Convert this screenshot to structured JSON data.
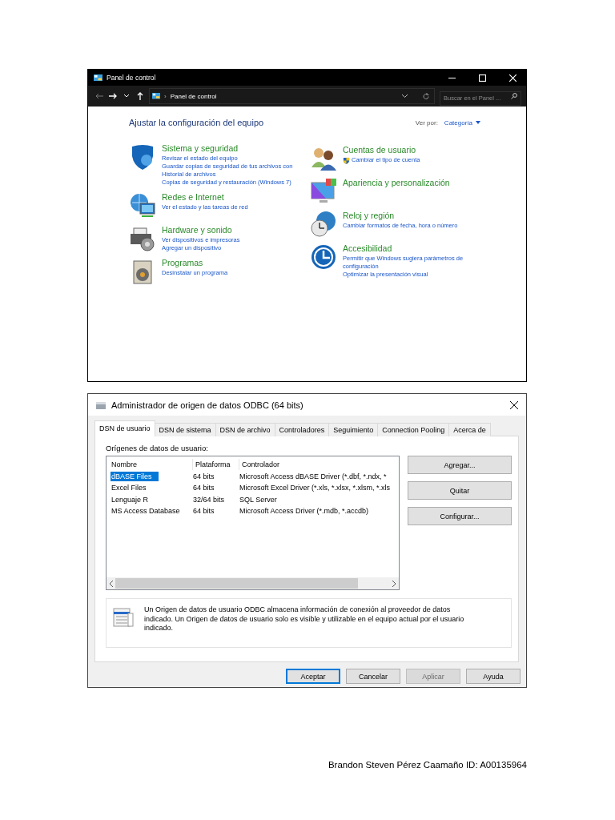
{
  "control_panel": {
    "title": "Panel de control",
    "address": {
      "separator": "›",
      "path": "Panel de control"
    },
    "search": {
      "placeholder": "Buscar en el Panel ..."
    },
    "heading": "Ajustar la configuración del equipo",
    "view_by": {
      "label": "Ver por:",
      "value": "Categoría"
    },
    "left_categories": [
      {
        "title": "Sistema y seguridad",
        "links": [
          {
            "text": "Revisar el estado del equipo",
            "kind": "plain"
          },
          {
            "text": "Guardar copias de seguridad de tus archivos con Historial de archivos",
            "kind": "plain"
          },
          {
            "text": "Copias de seguridad y restauración (Windows 7)",
            "kind": "plain"
          }
        ]
      },
      {
        "title": "Redes e Internet",
        "links": [
          {
            "text": "Ver el estado y las tareas de red",
            "kind": "plain"
          }
        ]
      },
      {
        "title": "Hardware y sonido",
        "links": [
          {
            "text": "Ver dispositivos e impresoras",
            "kind": "plain"
          },
          {
            "text": "Agregar un dispositivo",
            "kind": "plain"
          }
        ]
      },
      {
        "title": "Programas",
        "links": [
          {
            "text": "Desinstalar un programa",
            "kind": "plain"
          }
        ]
      }
    ],
    "right_categories": [
      {
        "title": "Cuentas de usuario",
        "links": [
          {
            "text": "Cambiar el tipo de cuenta",
            "kind": "admin"
          }
        ]
      },
      {
        "title": "Apariencia y personalización"
      },
      {
        "title": "Reloj y región",
        "links": [
          {
            "text": "Cambiar formatos de fecha, hora o número",
            "kind": "plain"
          }
        ]
      },
      {
        "title": "Accesibilidad",
        "links": [
          {
            "text": "Permitir que Windows sugiera parámetros de configuración",
            "kind": "plain"
          },
          {
            "text": "Optimizar la presentación visual",
            "kind": "plain"
          }
        ]
      }
    ]
  },
  "odbc": {
    "title": "Administrador de origen de datos ODBC (64 bits)",
    "tabs": [
      {
        "label": "DSN de usuario",
        "selected": true
      },
      {
        "label": "DSN de sistema",
        "selected": false
      },
      {
        "label": "DSN de archivo",
        "selected": false
      },
      {
        "label": "Controladores",
        "selected": false
      },
      {
        "label": "Seguimiento",
        "selected": false
      },
      {
        "label": "Connection Pooling",
        "selected": false
      },
      {
        "label": "Acerca de",
        "selected": false
      }
    ],
    "list_label": "Orígenes de datos de usuario:",
    "columns": [
      "Nombre",
      "Plataforma",
      "Controlador"
    ],
    "rows": [
      {
        "cells": [
          "dBASE Files",
          "64 bits",
          "Microsoft Access dBASE Driver (*.dbf, *.ndx, *"
        ],
        "selected": true
      },
      {
        "cells": [
          "Excel Files",
          "64 bits",
          "Microsoft Excel Driver (*.xls, *.xlsx, *.xlsm, *.xls"
        ],
        "selected": false
      },
      {
        "cells": [
          "Lenguaje R",
          "32/64 bits",
          "SQL Server"
        ],
        "selected": false
      },
      {
        "cells": [
          "MS Access Database",
          "64 bits",
          "Microsoft Access Driver (*.mdb, *.accdb)"
        ],
        "selected": false
      }
    ],
    "side_buttons": [
      "Agregar...",
      "Quitar",
      "Configurar..."
    ],
    "info": "Un Origen de datos de usuario ODBC almacena información de conexión al proveedor de datos indicado. Un Origen de datos de usuario solo es visible y utilizable en el equipo actual por el usuario indicado.",
    "footer_buttons": [
      {
        "label": "Aceptar",
        "default": true,
        "disabled": false
      },
      {
        "label": "Cancelar",
        "default": false,
        "disabled": false
      },
      {
        "label": "Aplicar",
        "default": false,
        "disabled": true
      },
      {
        "label": "Ayuda",
        "default": false,
        "disabled": false
      }
    ]
  },
  "caption": "Brandon Steven Pérez Caamaño ID: A00135964"
}
